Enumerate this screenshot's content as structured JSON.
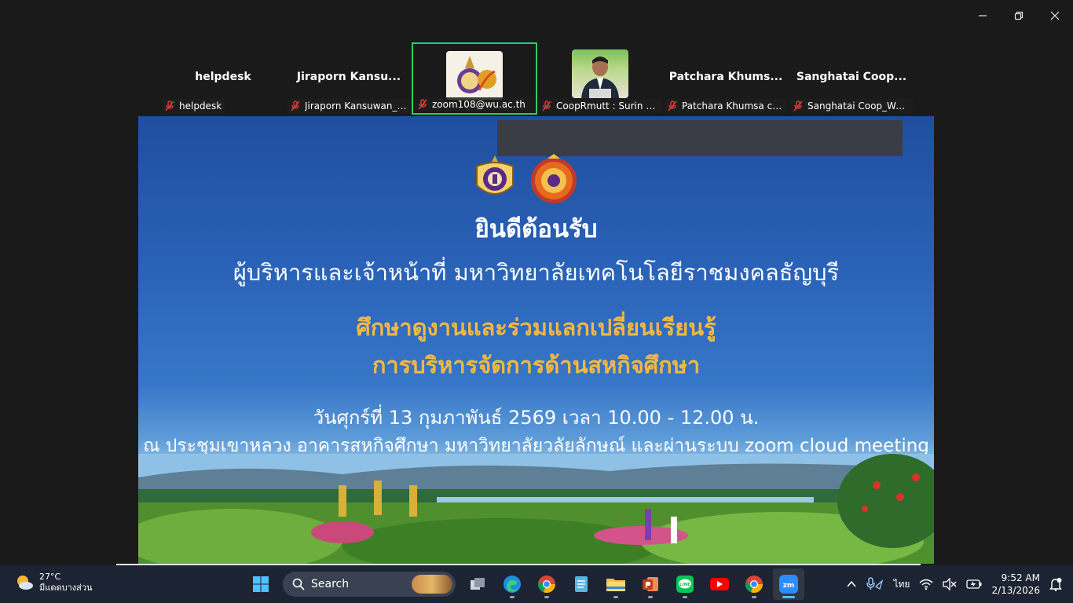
{
  "window": {
    "controls": [
      "minimize",
      "restore",
      "close"
    ]
  },
  "participants": [
    {
      "name": "helpdesk",
      "label": "helpdesk",
      "muted": true,
      "video": false
    },
    {
      "name": "Jiraporn  Kansu...",
      "label": "Jiraporn Kansuwan_C...",
      "muted": true,
      "video": false
    },
    {
      "name": "",
      "label": "zoom108@wu.ac.th",
      "muted": true,
      "video": true,
      "active": true
    },
    {
      "name": "",
      "label": "CoopRmutt : Surin ng...",
      "muted": true,
      "video": true
    },
    {
      "name": "Patchara  Khums...",
      "label": "Patchara Khumsa coop",
      "muted": true,
      "video": false
    },
    {
      "name": "Sanghatai  Coop...",
      "label": "Sanghatai Coop_Wala...",
      "muted": true,
      "video": false
    }
  ],
  "slide": {
    "welcome": "ยินดีต้อนรับ",
    "subtitle": "ผู้บริหารและเจ้าหน้าที่ มหาวิทยาลัยเทคโนโลยีราชมงคลธัญบุรี",
    "topic_line1": "ศึกษาดูงานและร่วมแลกเปลี่ยนเรียนรู้",
    "topic_line2": "การบริหารจัดการด้านสหกิจศึกษา",
    "date_line": "วันศุกร์ที่ 13 กุมภาพันธ์ 2569 เวลา 10.00 - 12.00 น.",
    "venue_line": "ณ ประชุมเขาหลวง อาคารสหกิจศึกษา มหาวิทยาลัยวลัยลักษณ์ และผ่านระบบ zoom cloud meeting"
  },
  "taskbar": {
    "weather": {
      "temp": "27°C",
      "condition": "มีแดดบางส่วน"
    },
    "search_label": "Search",
    "apps": [
      "start-icon",
      "task-view-icon",
      "edge-icon",
      "chrome-icon",
      "notepad-icon",
      "file-explorer-icon",
      "powerpoint-icon",
      "line-icon",
      "youtube-icon",
      "chrome-profile-icon",
      "zoom-icon"
    ],
    "language": "ไทย",
    "time": "9:52 AM",
    "date": "2/13/2026"
  },
  "colors": {
    "active_border": "#2ecc5f",
    "slide_gold": "#f4b942",
    "taskbar_bg": "#1c2433"
  }
}
